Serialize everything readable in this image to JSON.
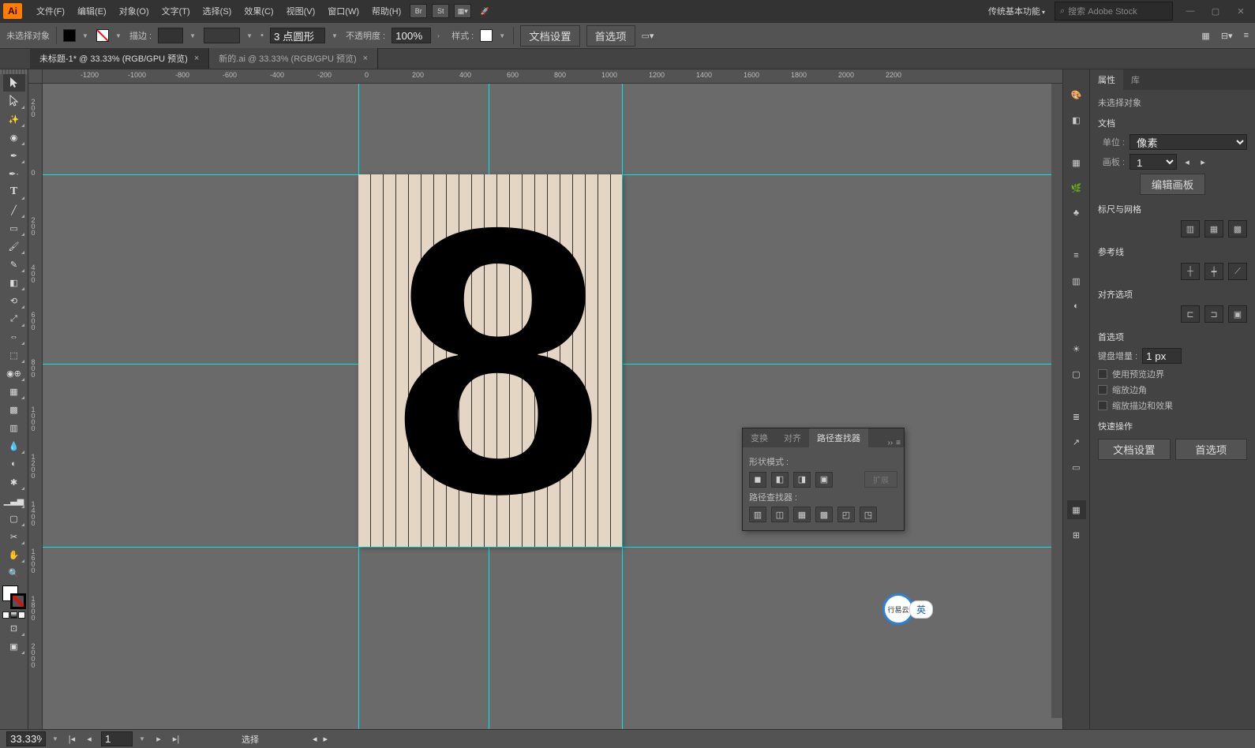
{
  "menu": {
    "items": [
      "文件(F)",
      "编辑(E)",
      "对象(O)",
      "文字(T)",
      "选择(S)",
      "效果(C)",
      "视图(V)",
      "窗口(W)",
      "帮助(H)"
    ],
    "workspace": "传统基本功能",
    "search_placeholder": "搜索 Adobe Stock"
  },
  "control": {
    "selection": "未选择对象",
    "stroke_label": "描边 :",
    "stroke_weight": "",
    "stroke_style_val": "3 点圆形",
    "opacity_label": "不透明度 :",
    "opacity": "100%",
    "style_label": "样式 :",
    "btn_docsetup": "文档设置",
    "btn_prefs": "首选项"
  },
  "tabs": {
    "t1": "未标题-1* @ 33.33% (RGB/GPU 预览)",
    "t2": "新的.ai @ 33.33% (RGB/GPU 预览)"
  },
  "ruler_h": [
    "-1200",
    "-1000",
    "-800",
    "-600",
    "-400",
    "-200",
    "0",
    "200",
    "400",
    "600",
    "800",
    "1000",
    "1200",
    "1400",
    "1600",
    "1800",
    "2000",
    "2200"
  ],
  "ruler_v": [
    "200",
    "0",
    "200",
    "400",
    "600",
    "800",
    "1000",
    "1200",
    "1400",
    "1600",
    "1800",
    "2000"
  ],
  "artboard_number": "8",
  "pathfinder": {
    "tab_transform": "变换",
    "tab_align": "对齐",
    "tab_pathfinder": "路径查找器",
    "shape_modes": "形状模式 :",
    "pathfinders": "路径查找器 :",
    "expand": "扩展"
  },
  "props": {
    "tab_props": "属性",
    "tab_lib": "库",
    "no_selection": "未选择对象",
    "doc": "文档",
    "unit_label": "单位 :",
    "unit_value": "像素",
    "artboard_label": "画板 :",
    "artboard_value": "1",
    "edit_artboard": "编辑画板",
    "ruler_grid": "标尺与网格",
    "guides": "参考线",
    "align_options": "对齐选项",
    "prefs": "首选项",
    "keyboard_inc": "键盘增量 :",
    "keyboard_inc_val": "1 px",
    "chk_preview": "使用预览边界",
    "chk_scale_corners": "缩放边角",
    "chk_scale_stroke": "缩放描边和效果",
    "quick_actions": "快速操作",
    "btn_docsetup": "文档设置",
    "btn_prefs": "首选项"
  },
  "status": {
    "zoom": "33.33%",
    "artboard": "1",
    "tool": "选择"
  },
  "ime": {
    "text": "行易云",
    "lang": "英"
  }
}
